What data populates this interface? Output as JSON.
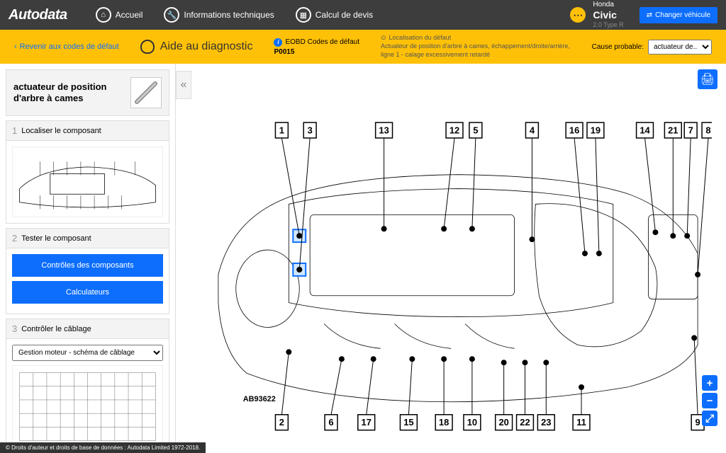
{
  "nav": {
    "brand": "Autodata",
    "home": "Accueil",
    "tech": "Informations techniques",
    "quote": "Calcul de devis"
  },
  "vehicle": {
    "make": "Honda",
    "model": "Civic",
    "variant": "2.0 Type R",
    "change_btn": "Changer véhicule"
  },
  "yellowbar": {
    "back": "Revenir aux codes de défaut",
    "aid_title": "Aide au diagnostic",
    "eobd_label": "EOBD Codes de défaut",
    "code": "P0015",
    "loc_title": "Localisation du défaut",
    "loc_desc": "Actuateur de position d'arbre à cames, échappement/droite/arrière, ligne 1 - calage excessivement retardé",
    "cause_label": "Cause probable:",
    "cause_selected": "actuateur de..."
  },
  "sidebar": {
    "comp_title": "actuateur de position d'arbre à cames",
    "step1": "Localiser le composant",
    "step2": "Tester le composant",
    "btn_controls": "Contrôles des composants",
    "btn_ecus": "Calculateurs",
    "step3": "Contrôler le câblage",
    "wiring_selected": "Gestion moteur - schéma de câblage"
  },
  "diagram": {
    "ref": "AB93622",
    "top_callouts": [
      "1",
      "3",
      "13",
      "12",
      "5",
      "4",
      "16",
      "19",
      "14",
      "21",
      "7",
      "8"
    ],
    "bottom_callouts": [
      "2",
      "6",
      "17",
      "15",
      "18",
      "10",
      "20",
      "22",
      "23",
      "11",
      "9"
    ]
  },
  "footer": "© Droits d'auteur et droits de base de données : Autodata Limited 1972-2018."
}
